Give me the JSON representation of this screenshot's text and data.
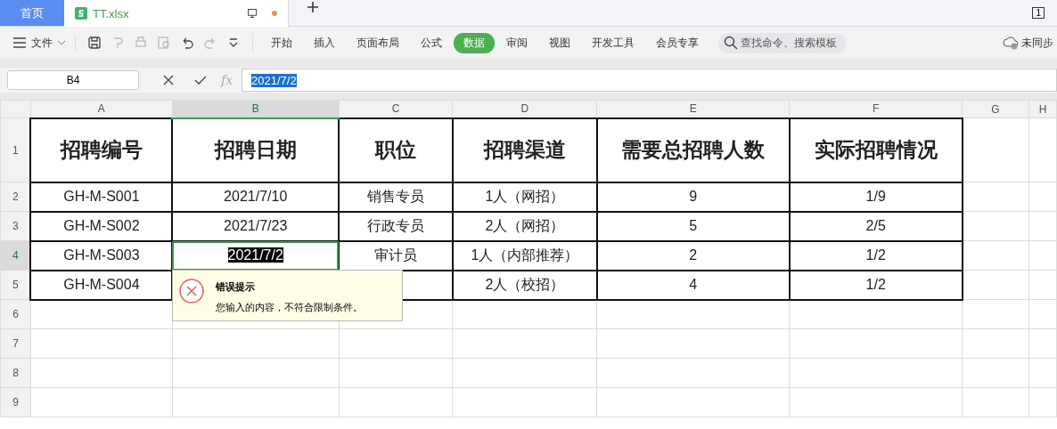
{
  "tabs": [
    {
      "label": "首页",
      "kind": "home",
      "selected": false
    },
    {
      "label": "TT.xlsx",
      "kind": "file",
      "selected": true,
      "unsaved": true
    }
  ],
  "window_count": "1",
  "menu": {
    "label": "文件"
  },
  "ribbon_tabs": [
    {
      "label": "开始",
      "selected": false
    },
    {
      "label": "插入",
      "selected": false
    },
    {
      "label": "页面布局",
      "selected": false
    },
    {
      "label": "公式",
      "selected": false
    },
    {
      "label": "数据",
      "selected": true
    },
    {
      "label": "审阅",
      "selected": false
    },
    {
      "label": "视图",
      "selected": false
    },
    {
      "label": "开发工具",
      "selected": false
    },
    {
      "label": "会员专享",
      "selected": false
    }
  ],
  "search": {
    "placeholder": "查找命令、搜索模板"
  },
  "sync": {
    "label": "未同步"
  },
  "formula_bar": {
    "cell_ref": "B4",
    "value": "2021/7/2",
    "function_label": "fx"
  },
  "columns": [
    {
      "label": "A",
      "selected": false
    },
    {
      "label": "B",
      "selected": true
    },
    {
      "label": "C",
      "selected": false
    },
    {
      "label": "D",
      "selected": false
    },
    {
      "label": "E",
      "selected": false
    },
    {
      "label": "F",
      "selected": false
    },
    {
      "label": "G",
      "selected": false
    },
    {
      "label": "H",
      "selected": false
    }
  ],
  "rows": [
    {
      "label": "1",
      "kind": "header",
      "selected": false,
      "cells": [
        "招聘编号",
        "招聘日期",
        "职位",
        "招聘渠道",
        "需要总招聘人数",
        "实际招聘情况"
      ]
    },
    {
      "label": "2",
      "kind": "data",
      "selected": false,
      "cells": [
        "GH-M-S001",
        "2021/7/10",
        "销售专员",
        "1人（网招）",
        "9",
        "1/9"
      ]
    },
    {
      "label": "3",
      "kind": "data",
      "selected": false,
      "cells": [
        "GH-M-S002",
        "2021/7/23",
        "行政专员",
        "2人（网招）",
        "5",
        "2/5"
      ]
    },
    {
      "label": "4",
      "kind": "data",
      "selected": true,
      "cells": [
        "GH-M-S003",
        "2021/7/2",
        "审计员",
        "1人（内部推荐）",
        "2",
        "1/2"
      ]
    },
    {
      "label": "5",
      "kind": "data",
      "selected": false,
      "cells": [
        "GH-M-S004",
        null,
        null,
        "2人（校招）",
        "4",
        "1/2"
      ]
    },
    {
      "label": "6",
      "kind": "empty",
      "selected": false
    },
    {
      "label": "7",
      "kind": "empty",
      "selected": false
    },
    {
      "label": "8",
      "kind": "empty",
      "selected": false
    },
    {
      "label": "9",
      "kind": "empty",
      "selected": false
    }
  ],
  "tooltip": {
    "title": "错误提示",
    "message": "您输入的内容，不符合限制条件。"
  }
}
